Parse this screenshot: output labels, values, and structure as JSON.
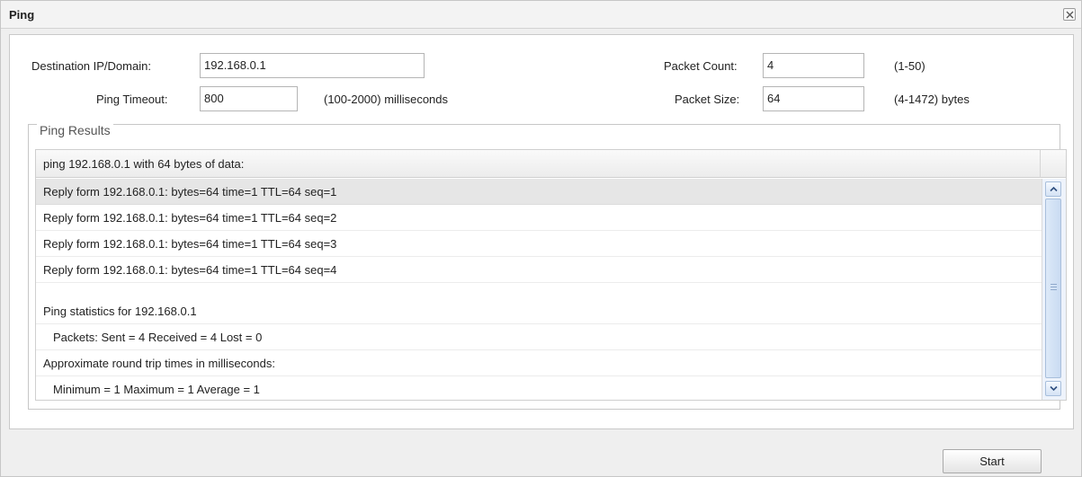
{
  "window": {
    "title": "Ping",
    "close_icon": "close-x-icon"
  },
  "form": {
    "destination_label": "Destination IP/Domain:",
    "destination_value": "192.168.0.1",
    "timeout_label": "Ping Timeout:",
    "timeout_value": "800",
    "timeout_hint": "(100-2000) milliseconds",
    "count_label": "Packet Count:",
    "count_value": "4",
    "count_hint": "(1-50)",
    "size_label": "Packet Size:",
    "size_value": "64",
    "size_hint": "(4-1472) bytes"
  },
  "results": {
    "legend": "Ping Results",
    "header": "ping 192.168.0.1 with 64 bytes of data:",
    "rows": [
      "Reply form 192.168.0.1: bytes=64 time=1 TTL=64 seq=1",
      "Reply form 192.168.0.1: bytes=64 time=1 TTL=64 seq=2",
      "Reply form 192.168.0.1: bytes=64 time=1 TTL=64 seq=3",
      "Reply form 192.168.0.1: bytes=64 time=1 TTL=64 seq=4",
      "",
      "Ping statistics for 192.168.0.1",
      "Packets: Sent = 4 Received = 4 Lost = 0",
      "Approximate round trip times in milliseconds:",
      "Minimum = 1 Maximum = 1 Average = 1"
    ]
  },
  "footer": {
    "start_label": "Start"
  },
  "colors": {
    "selected_row": "#e6e6e6",
    "scrollbar_accent": "#a8bfdc"
  }
}
